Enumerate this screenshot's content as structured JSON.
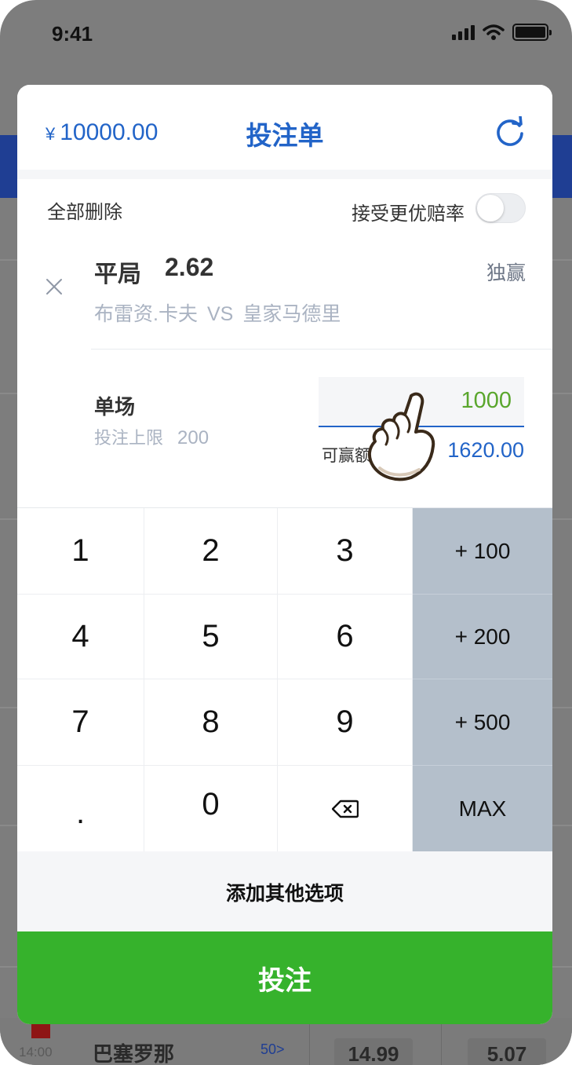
{
  "status_bar": {
    "time": "9:41"
  },
  "background": {
    "match_time": "14:00",
    "team": "巴塞罗那",
    "more": "50>",
    "odds": [
      "14.99",
      "5.07"
    ]
  },
  "bet_slip": {
    "balance_currency": "¥",
    "balance": "10000.00",
    "title": "投注单",
    "delete_all": "全部删除",
    "accept_better_odds": "接受更优赔率",
    "accept_better_odds_on": false,
    "selection": {
      "name": "平局",
      "odds": "2.62",
      "bet_type": "独赢",
      "home": "布雷资.卡夫",
      "vs": "VS",
      "away": "皇家马德里"
    },
    "single": {
      "label": "单场",
      "limit_label": "投注上限",
      "limit_value": "200",
      "stake": "1000",
      "win_label": "可赢额",
      "win_value": "1620.00"
    },
    "keypad": {
      "keys": [
        "1",
        "2",
        "3",
        "4",
        "5",
        "6",
        "7",
        "8",
        "9",
        ".",
        "0"
      ],
      "quick": [
        "+ 100",
        "+ 200",
        "+ 500",
        "MAX"
      ]
    },
    "add_options": "添加其他选项",
    "submit": "投注"
  },
  "colors": {
    "accent_blue": "#2264c8",
    "submit_green": "#36b22c",
    "stake_green": "#5aa62d",
    "quick_key_bg": "#b4bfcb"
  },
  "icons": [
    "refresh-icon",
    "close-icon",
    "backspace-icon",
    "hand-pointer-icon",
    "signal-icon",
    "wifi-icon",
    "battery-icon"
  ]
}
